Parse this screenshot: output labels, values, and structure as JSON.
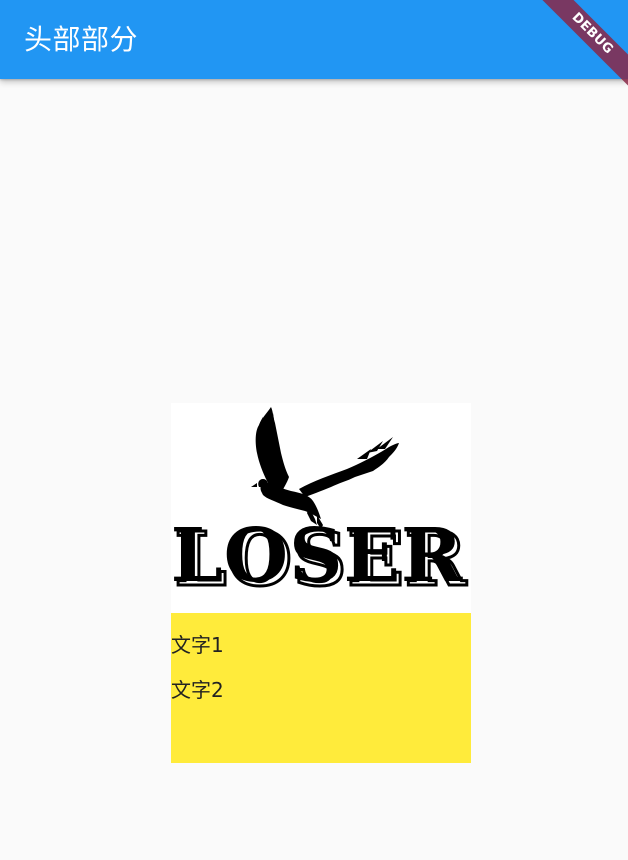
{
  "app_bar": {
    "title": "头部部分",
    "color": "#2196f3"
  },
  "debug_banner": {
    "label": "DEBUG"
  },
  "card": {
    "logo": {
      "icon": "eagle-icon",
      "wordmark": "LOSER"
    },
    "text_panel": {
      "background": "#ffeb3b",
      "lines": [
        "文字1",
        "文字2"
      ]
    }
  }
}
